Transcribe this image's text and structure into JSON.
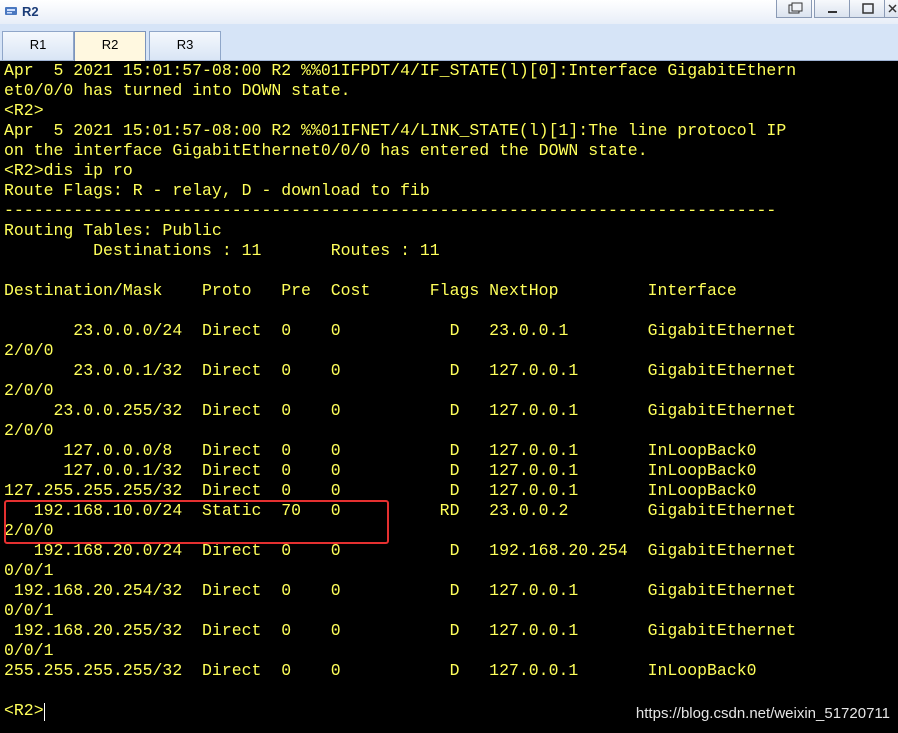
{
  "window": {
    "title": "R2",
    "buttons": [
      "restore",
      "minimize",
      "maximize",
      "close"
    ]
  },
  "tabs": [
    {
      "label": "R1",
      "active": false
    },
    {
      "label": "R2",
      "active": true
    },
    {
      "label": "R3",
      "active": false
    }
  ],
  "terminal": {
    "text": "Apr  5 2021 15:01:57-08:00 R2 %%01IFPDT/4/IF_STATE(l)[0]:Interface GigabitEthern\net0/0/0 has turned into DOWN state.\n<R2>\nApr  5 2021 15:01:57-08:00 R2 %%01IFNET/4/LINK_STATE(l)[1]:The line protocol IP\non the interface GigabitEthernet0/0/0 has entered the DOWN state.\n<R2>dis ip ro\nRoute Flags: R - relay, D - download to fib\n------------------------------------------------------------------------------\nRouting Tables: Public\n         Destinations : 11       Routes : 11\n\nDestination/Mask    Proto   Pre  Cost      Flags NextHop         Interface\n\n       23.0.0.0/24  Direct  0    0           D   23.0.0.1        GigabitEthernet\n2/0/0\n       23.0.0.1/32  Direct  0    0           D   127.0.0.1       GigabitEthernet\n2/0/0\n     23.0.0.255/32  Direct  0    0           D   127.0.0.1       GigabitEthernet\n2/0/0\n      127.0.0.0/8   Direct  0    0           D   127.0.0.1       InLoopBack0\n      127.0.0.1/32  Direct  0    0           D   127.0.0.1       InLoopBack0\n127.255.255.255/32  Direct  0    0           D   127.0.0.1       InLoopBack0\n   192.168.10.0/24  Static  70   0          RD   23.0.0.2        GigabitEthernet\n2/0/0\n   192.168.20.0/24  Direct  0    0           D   192.168.20.254  GigabitEthernet\n0/0/1\n 192.168.20.254/32  Direct  0    0           D   127.0.0.1       GigabitEthernet\n0/0/1\n 192.168.20.255/32  Direct  0    0           D   127.0.0.1       GigabitEthernet\n0/0/1\n255.255.255.255/32  Direct  0    0           D   127.0.0.1       InLoopBack0\n\n<R2>"
  },
  "watermark": "https://blog.csdn.net/weixin_51720711",
  "colors": {
    "terminal_bg": "#000000",
    "terminal_fg": "#ffff5a",
    "highlight": "#e53030",
    "tab_active": "#fff8e0"
  }
}
